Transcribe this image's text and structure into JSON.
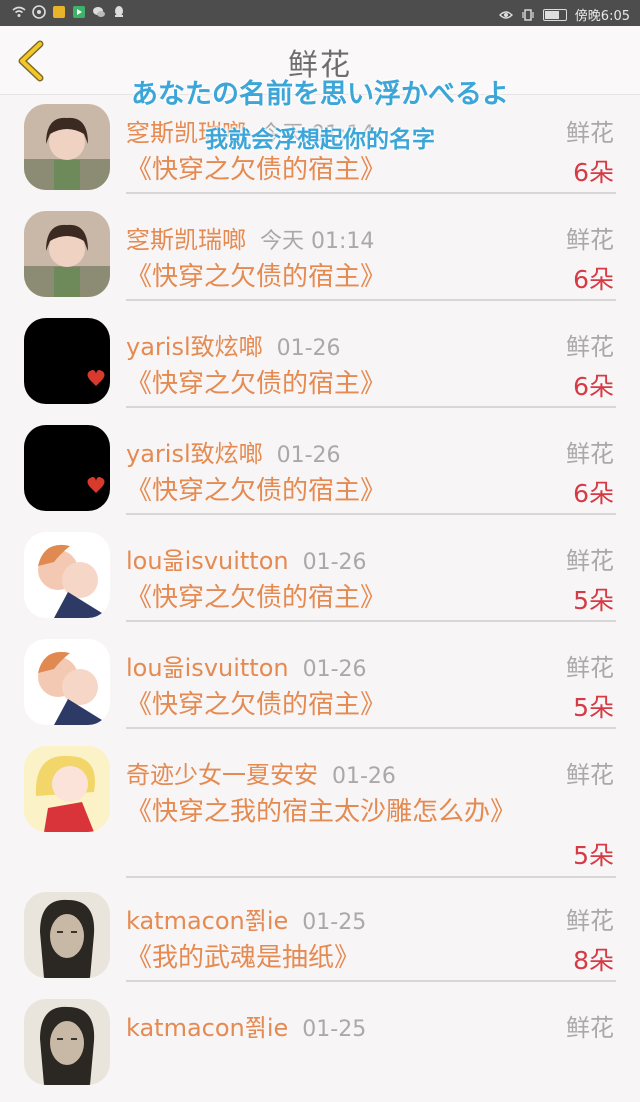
{
  "status_bar": {
    "right_text": "傍晚6:05"
  },
  "header": {
    "title": "鲜花"
  },
  "subtitle_overlay": {
    "line1": "あなたの名前を思い浮かべるよ",
    "line2": "我就会浮想起你的名字"
  },
  "rows": [
    {
      "name": "窆斯凯瑞啷",
      "time": "今天 01:14",
      "type": "鲜花",
      "book": "《快穿之欠债的宿主》",
      "count": "6朵",
      "avatar": "photo-girl-icon"
    },
    {
      "name": "窆斯凯瑞啷",
      "time": "今天 01:14",
      "type": "鲜花",
      "book": "《快穿之欠债的宿主》",
      "count": "6朵",
      "avatar": "photo-girl-icon"
    },
    {
      "name": "yarisl致炫啷",
      "time": "01-26",
      "type": "鲜花",
      "book": "《快穿之欠债的宿主》",
      "count": "6朵",
      "avatar": "black-heart-icon"
    },
    {
      "name": "yarisl致炫啷",
      "time": "01-26",
      "type": "鲜花",
      "book": "《快穿之欠债的宿主》",
      "count": "6朵",
      "avatar": "black-heart-icon"
    },
    {
      "name": "lou읆isvuitton",
      "time": "01-26",
      "type": "鲜花",
      "book": "《快穿之欠债的宿主》",
      "count": "5朵",
      "avatar": "anime-couple-icon"
    },
    {
      "name": "lou읆isvuitton",
      "time": "01-26",
      "type": "鲜花",
      "book": "《快穿之欠债的宿主》",
      "count": "5朵",
      "avatar": "anime-couple-icon"
    },
    {
      "name": "奇迹少女一夏安安",
      "time": "01-26",
      "type": "鲜花",
      "book": "《快穿之我的宿主太沙雕怎么办》",
      "count": "5朵",
      "avatar": "anime-girl-icon"
    },
    {
      "name": "katmacon쬙ie",
      "time": "01-25",
      "type": "鲜花",
      "book": "《我的武魂是抽纸》",
      "count": "8朵",
      "avatar": "sketch-portrait-icon"
    },
    {
      "name": "katmacon쬙ie",
      "time": "01-25",
      "type": "鲜花",
      "book": "",
      "count": "",
      "avatar": "sketch-portrait-icon"
    }
  ]
}
